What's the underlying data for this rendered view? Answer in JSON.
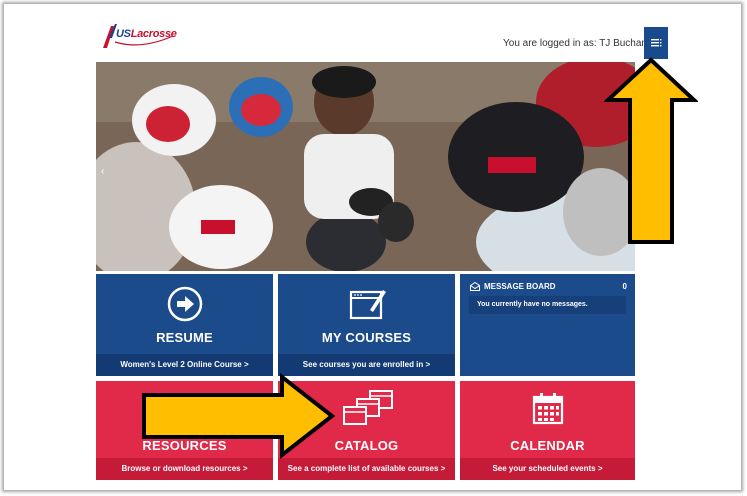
{
  "header": {
    "logo_us": "US",
    "logo_rest": "Lacrosse",
    "login_text": "You are logged in as: TJ Buchanan"
  },
  "colors": {
    "blue": "#1c4b8b",
    "red": "#e12949",
    "arrow": "#ffbf00"
  },
  "tiles": {
    "resume": {
      "title": "RESUME",
      "sub": "Women's Level 2 Online Course  >"
    },
    "my_courses": {
      "title": "MY COURSES",
      "sub": "See courses you are enrolled in  >"
    },
    "message_board": {
      "title": "MESSAGE BOARD",
      "count": "0",
      "body": "You currently have no messages."
    },
    "resources": {
      "title": "RESOURCES",
      "sub": "Browse or download resources  >"
    },
    "catalog": {
      "title": "CATALOG",
      "sub": "See a complete list of available courses  >"
    },
    "calendar": {
      "title": "CALENDAR",
      "sub": "See your scheduled events  >"
    }
  }
}
